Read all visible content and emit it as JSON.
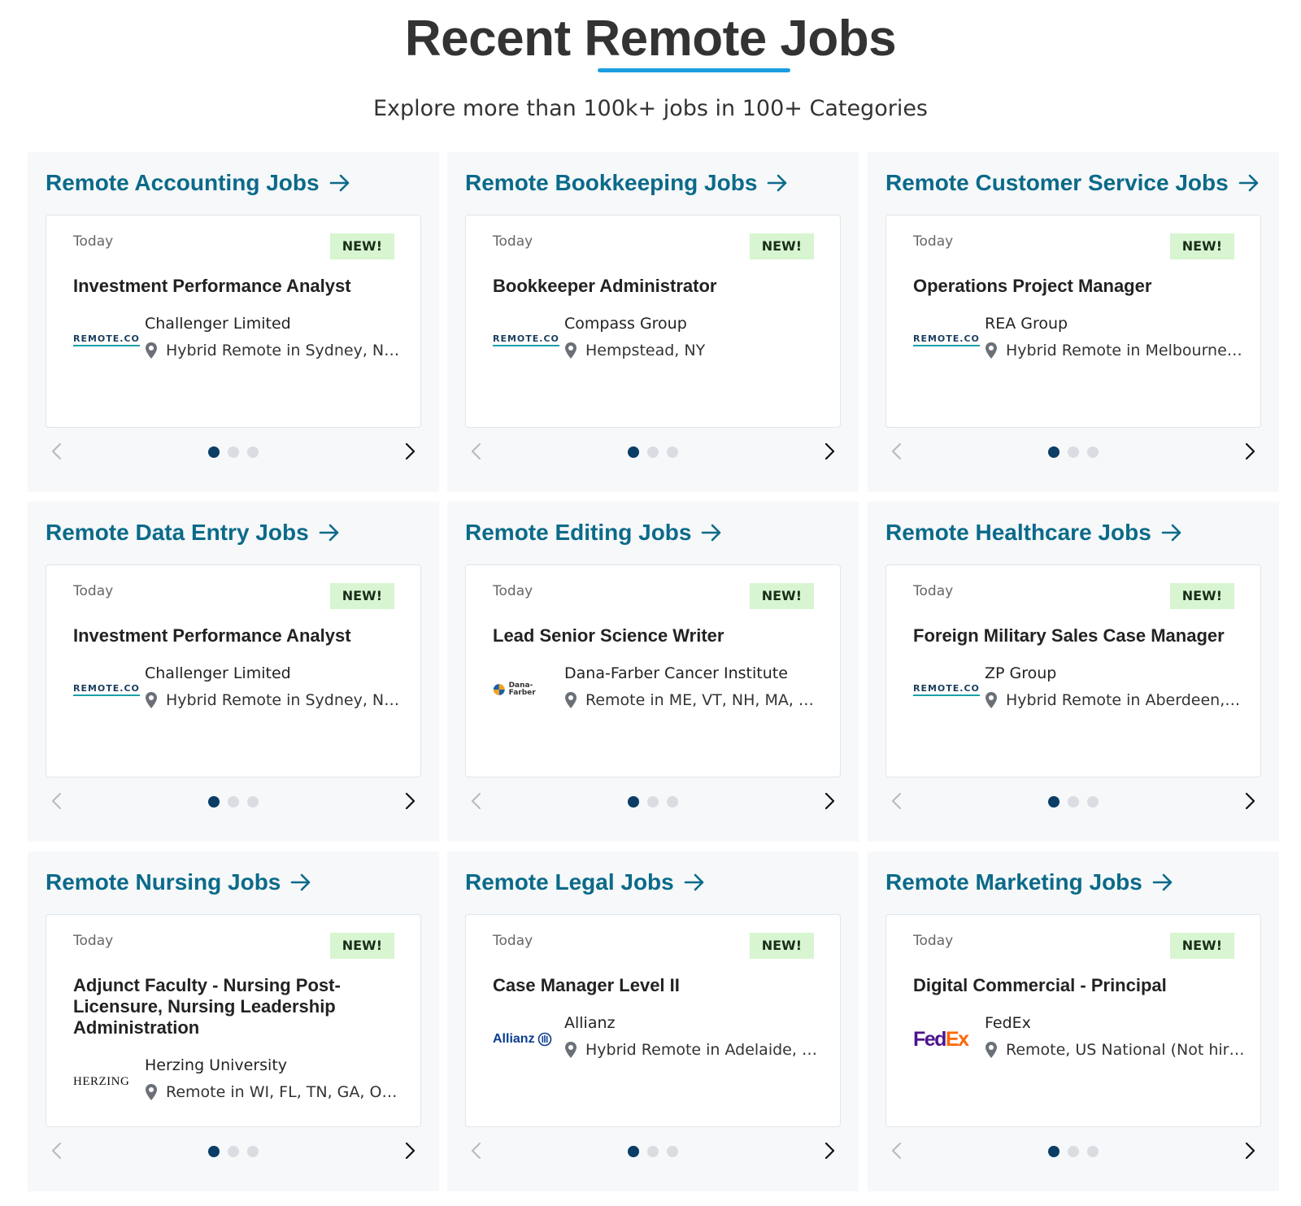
{
  "header": {
    "title": "Recent Remote Jobs",
    "subtitle": "Explore more than 100k+ jobs in 100+ Categories",
    "accent_color": "#1a9ee0"
  },
  "colors": {
    "category_link": "#0b6a89",
    "badge_bg": "#d7f5d1",
    "dot_active": "#0b3d66",
    "dot_inactive": "#d9dde2",
    "panel_bg": "#f6f8fa"
  },
  "categories": [
    {
      "link": "Remote Accounting Jobs",
      "date": "Today",
      "badge": "NEW!",
      "job_title": "Investment Performance Analyst",
      "logo": "REMOTE.CO",
      "company": "Challenger Limited",
      "location": "Hybrid Remote in Sydney, NSW, Australia"
    },
    {
      "link": "Remote Bookkeeping Jobs",
      "date": "Today",
      "badge": "NEW!",
      "job_title": "Bookkeeper Administrator",
      "logo": "REMOTE.CO",
      "company": "Compass Group",
      "location": "Hempstead, NY"
    },
    {
      "link": "Remote Customer Service Jobs",
      "date": "Today",
      "badge": "NEW!",
      "job_title": "Operations Project Manager",
      "logo": "REMOTE.CO",
      "company": "REA Group",
      "location": "Hybrid Remote in Melbourne, Victoria, Australia"
    },
    {
      "link": "Remote Data Entry Jobs",
      "date": "Today",
      "badge": "NEW!",
      "job_title": "Investment Performance Analyst",
      "logo": "REMOTE.CO",
      "company": "Challenger Limited",
      "location": "Hybrid Remote in Sydney, NSW, Australia"
    },
    {
      "link": "Remote Editing Jobs",
      "date": "Today",
      "badge": "NEW!",
      "job_title": "Lead Senior Science Writer",
      "logo": "Dana-Farber",
      "company": "Dana-Farber Cancer Institute",
      "location": "Remote in ME, VT, NH, MA, CT, RI"
    },
    {
      "link": "Remote Healthcare Jobs",
      "date": "Today",
      "badge": "NEW!",
      "job_title": "Foreign Military Sales Case Manager",
      "logo": "REMOTE.CO",
      "company": "ZP Group",
      "location": "Hybrid Remote in Aberdeen, MD"
    },
    {
      "link": "Remote Nursing Jobs",
      "date": "Today",
      "badge": "NEW!",
      "job_title": "Adjunct Faculty - Nursing Post-Licensure, Nursing Leadership Administration",
      "logo": "HERZING",
      "company": "Herzing University",
      "location": "Remote in WI, FL, TN, GA, OH, MN"
    },
    {
      "link": "Remote Legal Jobs",
      "date": "Today",
      "badge": "NEW!",
      "job_title": "Case Manager Level II",
      "logo": "Allianz",
      "company": "Allianz",
      "location": "Hybrid Remote in Adelaide, SA, Australia"
    },
    {
      "link": "Remote Marketing Jobs",
      "date": "Today",
      "badge": "NEW!",
      "job_title": "Digital Commercial - Principal",
      "logo": "FedEx",
      "company": "FedEx",
      "location": "Remote, US National (Not hiring in all states)"
    }
  ],
  "carousel": {
    "dot_count": 3,
    "active_index": 0
  }
}
